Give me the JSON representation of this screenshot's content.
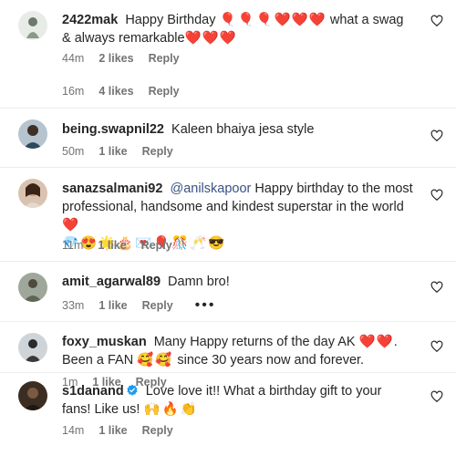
{
  "comments": [
    {
      "user": "2422mak",
      "text": "Happy Birthday",
      "emoji1": "🎈🎈🎈",
      "hearts1": "❤️❤️❤️",
      "text2": "what a swag & always remarkable",
      "hearts2": "❤️❤️❤️",
      "time": "44m",
      "likes": "2 likes",
      "reply": "Reply"
    },
    {
      "time": "16m",
      "likes": "4 likes",
      "reply": "Reply"
    },
    {
      "user": "being.swapnil22",
      "text": "Kaleen bhaiya jesa style",
      "time": "50m",
      "likes": "1 like",
      "reply": "Reply"
    },
    {
      "user": "sanazsalmani92",
      "mention": "@anilskapoor",
      "text": "Happy birthday to the most professional, handsome and kindest superstar in the world",
      "hearts": "❤️",
      "emojis": "💎😍🌟🎂💌🎈🎊🥂😎",
      "time": "11m",
      "likes": "1 like",
      "reply": "Reply"
    },
    {
      "user": "amit_agarwal89",
      "text": "Damn bro!",
      "time": "33m",
      "likes": "1 like",
      "reply": "Reply",
      "more": "•••"
    },
    {
      "user": "foxy_muskan",
      "text": "Many Happy returns of the day AK",
      "hearts": "❤️❤️",
      "text2": ". Been a FAN",
      "emojis": "🥰🥰",
      "text3": "since 30 years now and forever.",
      "time": "1m",
      "likes": "1 like",
      "reply": "Reply"
    },
    {
      "user": "s1danand",
      "text": "Love love it!! What a birthday gift to your fans! Like us!",
      "emojis": "🙌🔥👏",
      "time": "14m",
      "likes": "1 like",
      "reply": "Reply"
    }
  ],
  "colors": {
    "heart": "#ed1c3a",
    "mention": "#385185",
    "meta": "#737373",
    "verified": "#1d9bf0"
  }
}
